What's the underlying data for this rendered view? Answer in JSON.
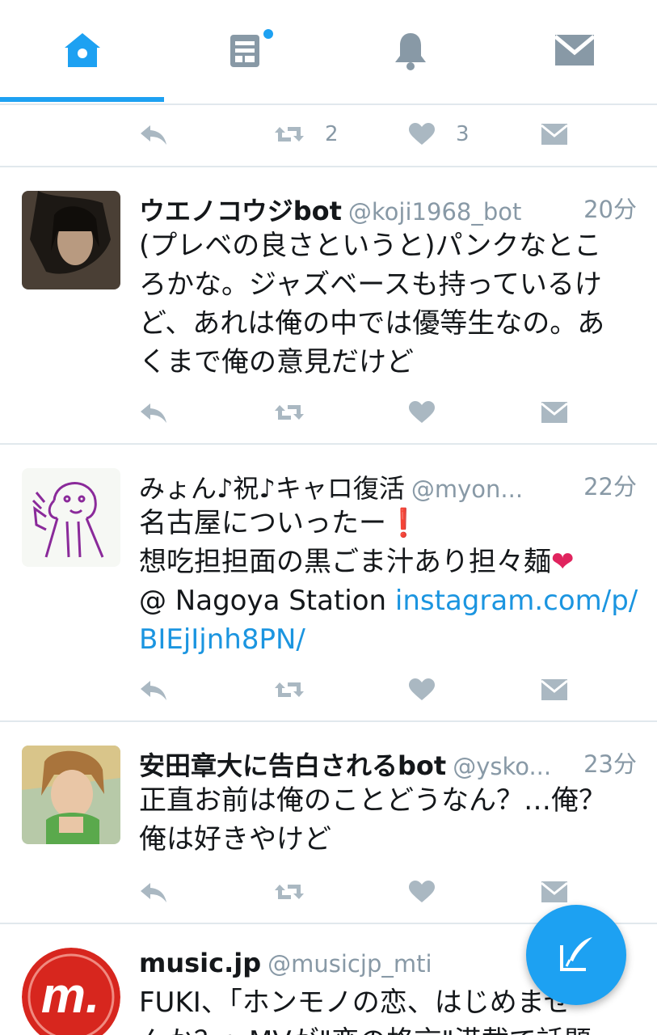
{
  "colors": {
    "accent": "#1da1f2",
    "link": "#1b95e0",
    "muted": "#8899a6"
  },
  "tabs": [
    {
      "icon": "home-icon",
      "active": true
    },
    {
      "icon": "moments-icon",
      "badge_dot": true
    },
    {
      "icon": "notifications-icon"
    },
    {
      "icon": "messages-icon"
    }
  ],
  "top_actions": {
    "retweet_count": "2",
    "like_count": "3"
  },
  "tweets": [
    {
      "name": "ウエノコウジbot",
      "handle": "@koji1968_bot",
      "time": "20分",
      "lines": [
        "(プレベの良さというと)パンクなとこ",
        "ろかな。ジャズベースも持っているけ",
        "ど、あれは俺の中では優等生なの。あ",
        "くまで俺の意見だけど"
      ]
    },
    {
      "name": "みょん♪祝♪キャロ復活",
      "handle": "@myon...",
      "time": "22分",
      "line1": "名古屋についったー",
      "line1_mark": "❗",
      "line2": "想吃担担面の黒ごま汁あり担々麺",
      "line2_mark": "❤",
      "line3_prefix": "@ Nagoya Station ",
      "link1": "instagram.com/p/",
      "link2": "BIEjIjnh8PN/"
    },
    {
      "name": "安田章大に告白されるbot",
      "handle": "@ysko...",
      "time": "23分",
      "lines": [
        "正直お前は俺のことどうなん？…俺？",
        "俺は好きやけど"
      ]
    },
    {
      "name": "music.jp",
      "handle": "@musicjp_mti",
      "lines": [
        "FUKI、「ホンモノの恋、はじめませ",
        "んか？」MVが\"恋の格言\"満載で話題"
      ]
    }
  ]
}
